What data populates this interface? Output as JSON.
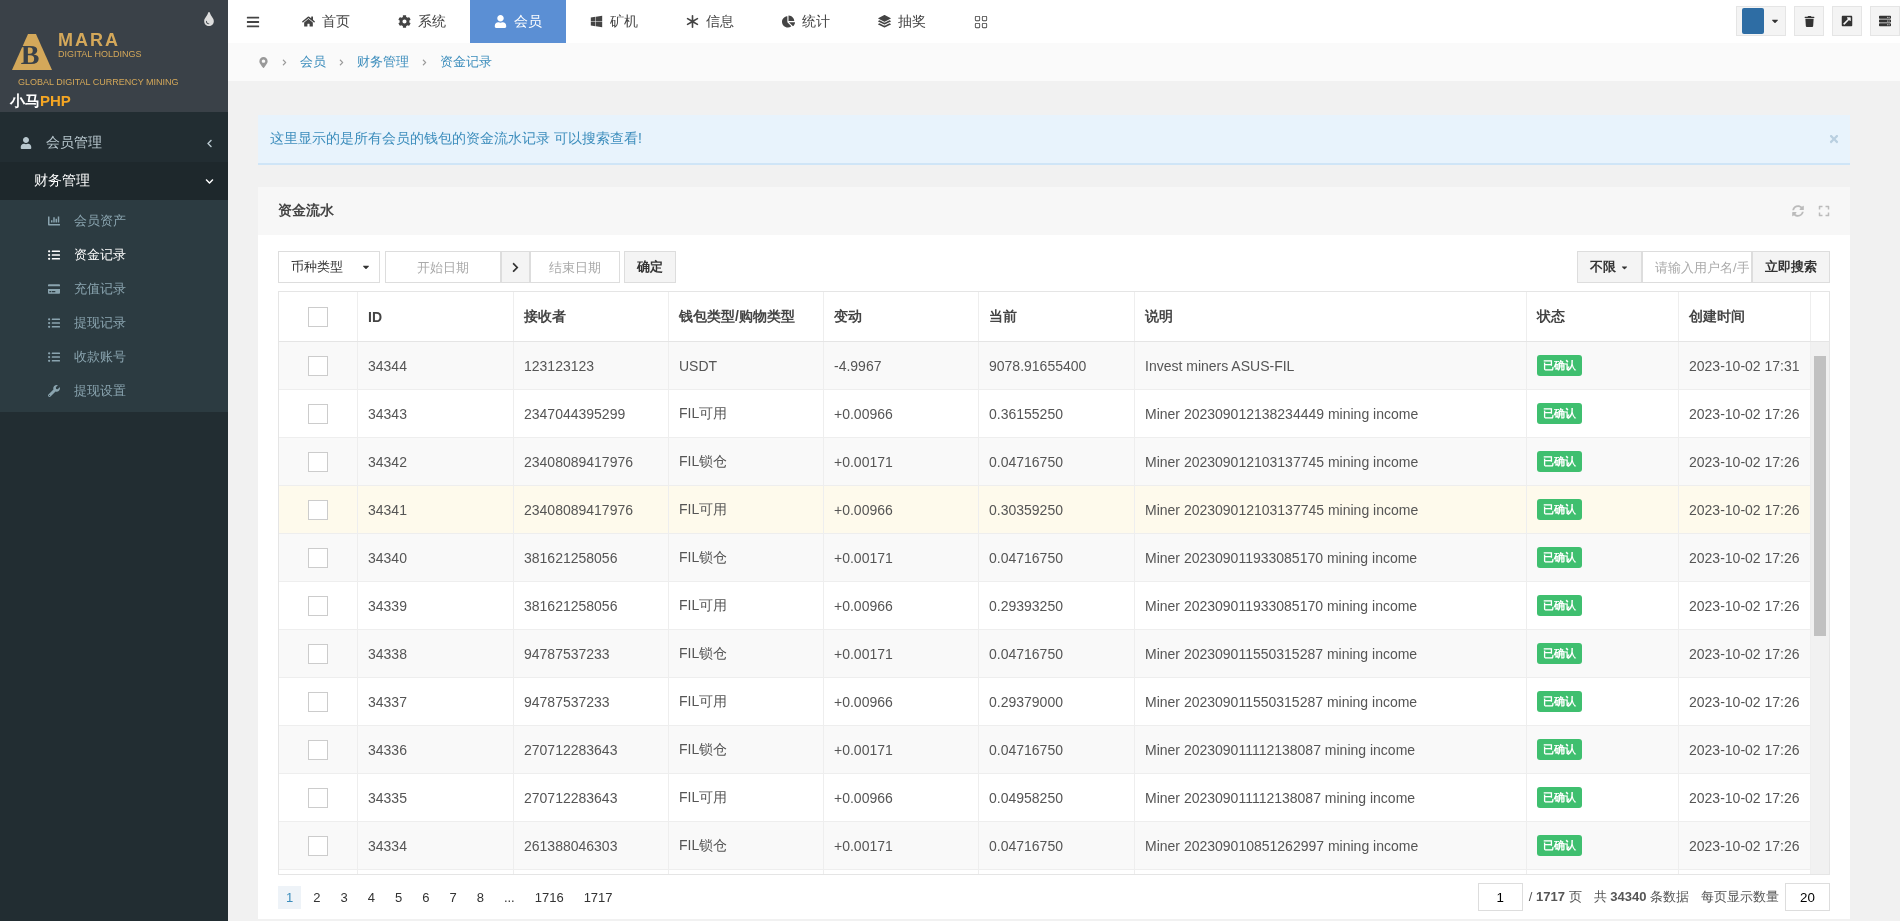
{
  "sidebar": {
    "logo": {
      "monogram": "B",
      "brand": "MARA",
      "tagline": "DIGITAL HOLDINGS",
      "subtag": "GLOBAL DIGITAL CURRENCY MINING",
      "product": "小马",
      "product_suffix": "PHP"
    },
    "menu": [
      {
        "label": "会员管理",
        "expanded": false
      },
      {
        "label": "财务管理",
        "expanded": true,
        "children": [
          {
            "label": "会员资产",
            "selected": false
          },
          {
            "label": "资金记录",
            "selected": true
          },
          {
            "label": "充值记录",
            "selected": false
          },
          {
            "label": "提现记录",
            "selected": false
          },
          {
            "label": "收款账号",
            "selected": false
          },
          {
            "label": "提现设置",
            "selected": false
          }
        ]
      }
    ]
  },
  "topnav": {
    "tabs": [
      {
        "label": "首页",
        "selected": false
      },
      {
        "label": "系统",
        "selected": false
      },
      {
        "label": "会员",
        "selected": true
      },
      {
        "label": "矿机",
        "selected": false
      },
      {
        "label": "信息",
        "selected": false
      },
      {
        "label": "统计",
        "selected": false
      },
      {
        "label": "抽奖",
        "selected": false
      }
    ]
  },
  "breadcrumb": [
    "会员",
    "财务管理",
    "资金记录"
  ],
  "alert": {
    "text": "这里显示的是所有会员的钱包的资金流水记录 可以搜索查看!"
  },
  "panel": {
    "title": "资金流水"
  },
  "filters": {
    "currency": "币种类型",
    "start_date": {
      "placeholder": "开始日期"
    },
    "end_date": {
      "placeholder": "结束日期"
    },
    "confirm": "确定",
    "scope": "不限",
    "search": {
      "placeholder": "请输入用户名/手"
    },
    "search_button": "立即搜索"
  },
  "table": {
    "select_all": false,
    "columns": [
      "ID",
      "接收者",
      "钱包类型/购物类型",
      "变动",
      "当前",
      "说明",
      "状态",
      "创建时间"
    ],
    "rows": [
      {
        "checked": false,
        "hovered": false,
        "cells": [
          "34344",
          "123123123",
          "USDT",
          "-4.9967",
          "9078.91655400",
          "Invest miners ASUS-FIL",
          "已确认",
          "2023-10-02 17:31"
        ]
      },
      {
        "checked": false,
        "hovered": false,
        "cells": [
          "34343",
          "2347044395299",
          "FIL可用",
          "+0.00966",
          "0.36155250",
          "Miner 202309012138234449 mining income",
          "已确认",
          "2023-10-02 17:26"
        ]
      },
      {
        "checked": false,
        "hovered": false,
        "cells": [
          "34342",
          "23408089417976",
          "FIL锁仓",
          "+0.00171",
          "0.04716750",
          "Miner 202309012103137745 mining income",
          "已确认",
          "2023-10-02 17:26"
        ]
      },
      {
        "checked": false,
        "hovered": true,
        "cells": [
          "34341",
          "23408089417976",
          "FIL可用",
          "+0.00966",
          "0.30359250",
          "Miner 202309012103137745 mining income",
          "已确认",
          "2023-10-02 17:26"
        ]
      },
      {
        "checked": false,
        "hovered": false,
        "cells": [
          "34340",
          "381621258056",
          "FIL锁仓",
          "+0.00171",
          "0.04716750",
          "Miner 202309011933085170 mining income",
          "已确认",
          "2023-10-02 17:26"
        ]
      },
      {
        "checked": false,
        "hovered": false,
        "cells": [
          "34339",
          "381621258056",
          "FIL可用",
          "+0.00966",
          "0.29393250",
          "Miner 202309011933085170 mining income",
          "已确认",
          "2023-10-02 17:26"
        ]
      },
      {
        "checked": false,
        "hovered": false,
        "cells": [
          "34338",
          "94787537233",
          "FIL锁仓",
          "+0.00171",
          "0.04716750",
          "Miner 202309011550315287 mining income",
          "已确认",
          "2023-10-02 17:26"
        ]
      },
      {
        "checked": false,
        "hovered": false,
        "cells": [
          "34337",
          "94787537233",
          "FIL可用",
          "+0.00966",
          "0.29379000",
          "Miner 202309011550315287 mining income",
          "已确认",
          "2023-10-02 17:26"
        ]
      },
      {
        "checked": false,
        "hovered": false,
        "cells": [
          "34336",
          "270712283643",
          "FIL锁仓",
          "+0.00171",
          "0.04716750",
          "Miner 202309011112138087 mining income",
          "已确认",
          "2023-10-02 17:26"
        ]
      },
      {
        "checked": false,
        "hovered": false,
        "cells": [
          "34335",
          "270712283643",
          "FIL可用",
          "+0.00966",
          "0.04958250",
          "Miner 202309011112138087 mining income",
          "已确认",
          "2023-10-02 17:26"
        ]
      },
      {
        "checked": false,
        "hovered": false,
        "cells": [
          "34334",
          "261388046303",
          "FIL锁仓",
          "+0.00171",
          "0.04716750",
          "Miner 202309010851262997 mining income",
          "已确认",
          "2023-10-02 17:26"
        ]
      }
    ]
  },
  "pagination": {
    "pages": [
      {
        "label": "1",
        "selected": true
      },
      {
        "label": "2",
        "selected": false
      },
      {
        "label": "3",
        "selected": false
      },
      {
        "label": "4",
        "selected": false
      },
      {
        "label": "5",
        "selected": false
      },
      {
        "label": "6",
        "selected": false
      },
      {
        "label": "7",
        "selected": false
      },
      {
        "label": "8",
        "selected": false
      },
      {
        "label": "...",
        "selected": false
      },
      {
        "label": "1716",
        "selected": false
      },
      {
        "label": "1717",
        "selected": false
      }
    ],
    "page_input": "1",
    "total_pages": "/ **1717** 页",
    "total": "共 **34340** 条数据",
    "page_size_label": "每页显示数量",
    "page_size": "20"
  }
}
